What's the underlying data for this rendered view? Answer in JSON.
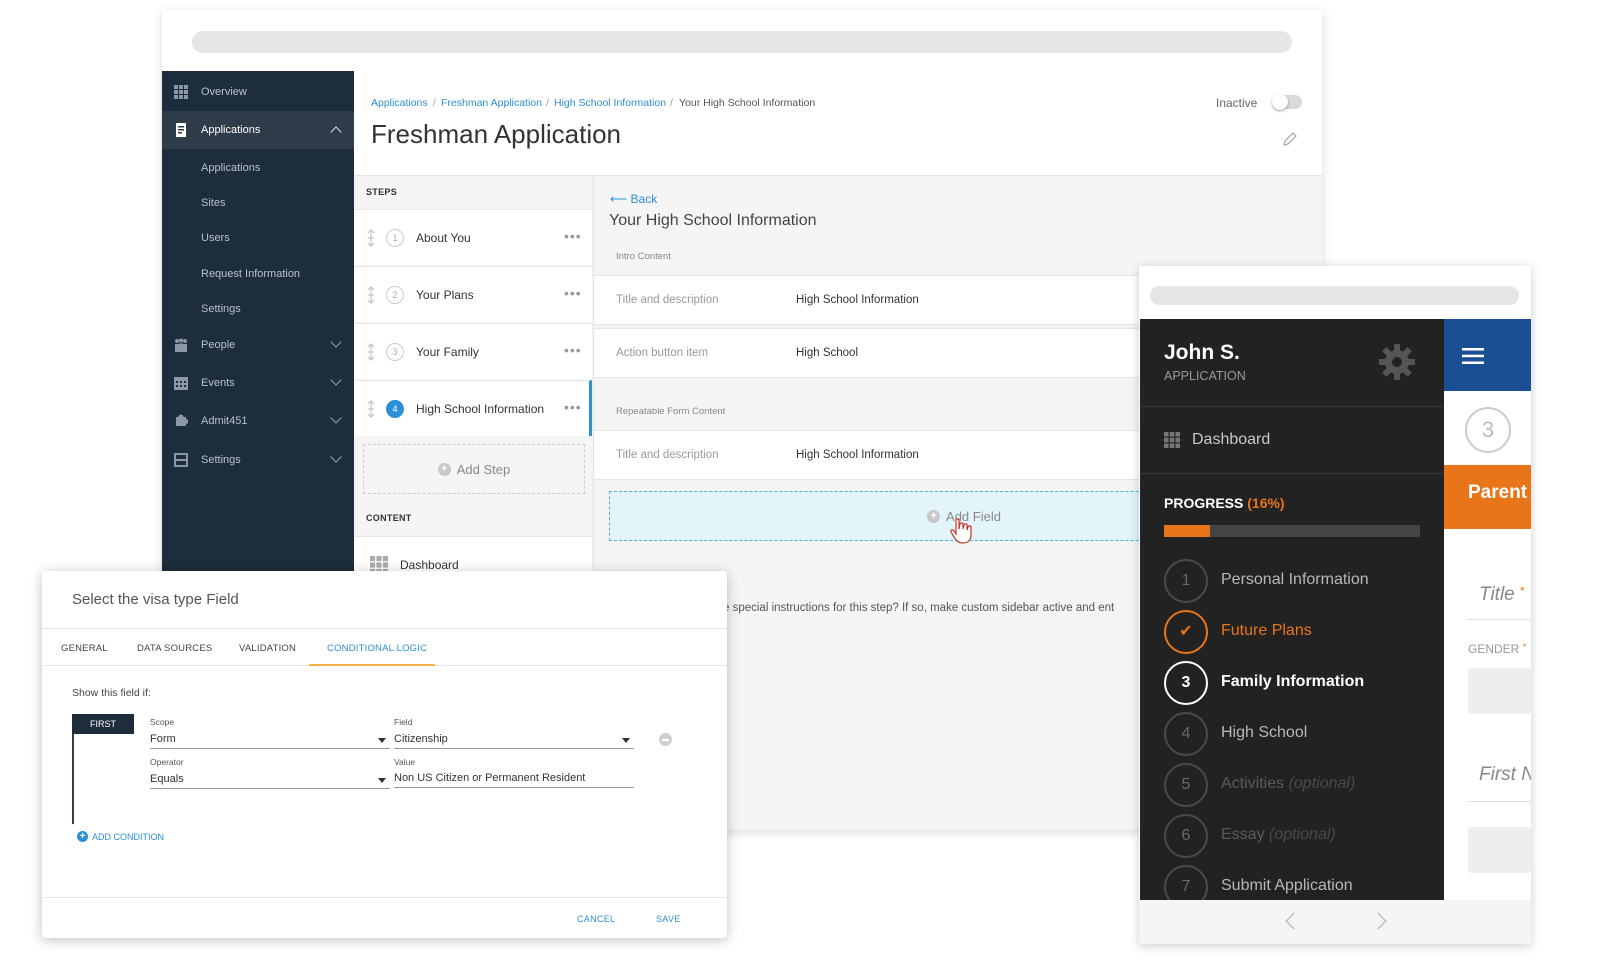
{
  "sidebar": {
    "items": [
      {
        "label": "Overview",
        "icon": "grid-icon"
      },
      {
        "label": "Applications",
        "icon": "document-icon"
      },
      {
        "label": "People",
        "icon": "people-icon"
      },
      {
        "label": "Events",
        "icon": "calendar-icon"
      },
      {
        "label": "Admit451",
        "icon": "puzzle-icon"
      },
      {
        "label": "Settings",
        "icon": "settings-panel-icon"
      }
    ],
    "sub_items": [
      "Applications",
      "Sites",
      "Users",
      "Request Information",
      "Settings"
    ]
  },
  "breadcrumb": [
    "Applications",
    "Freshman Application",
    "High School Information",
    "Your High School Information"
  ],
  "breadcrumb_separator": "/",
  "page_title": "Freshman Application",
  "status": {
    "label": "Inactive"
  },
  "steps_panel": {
    "header": "STEPS",
    "steps": [
      {
        "number": "1",
        "name": "About You"
      },
      {
        "number": "2",
        "name": "Your Plans"
      },
      {
        "number": "3",
        "name": "Your Family"
      },
      {
        "number": "4",
        "name": "High School Information"
      }
    ],
    "add_step_label": "Add Step",
    "content_header": "CONTENT",
    "content_items": [
      "Dashboard"
    ]
  },
  "detail": {
    "back_label": "Back",
    "title": "Your High School Information",
    "intro_label": "Intro Content",
    "rows": [
      {
        "key": "Title and description",
        "value": "High School Information"
      },
      {
        "key": "Action button item",
        "value": "High School"
      }
    ],
    "repeatable_label": "Repeatable Form Content",
    "repeatable_rows": [
      {
        "key": "Title and description",
        "value": "High School Information"
      }
    ],
    "add_field_label": "Add Field",
    "custom_sidebar_text": "e special instructions for this step? If so, make custom sidebar active and ent"
  },
  "modal": {
    "title": "Select the visa type Field",
    "tabs": [
      "GENERAL",
      "DATA SOURCES",
      "VALIDATION",
      "CONDITIONAL LOGIC"
    ],
    "active_tab": "CONDITIONAL LOGIC",
    "show_if_label": "Show this field if:",
    "first_badge": "FIRST",
    "condition": {
      "scope_label": "Scope",
      "scope_value": "Form",
      "field_label": "Field",
      "field_value": "Citizenship",
      "operator_label": "Operator",
      "operator_value": "Equals",
      "value_label": "Value",
      "value_value": "Non US Citizen or Permanent Resident"
    },
    "add_condition_label": "ADD CONDITION",
    "cancel_label": "CANCEL",
    "save_label": "SAVE"
  },
  "mobile": {
    "user_name": "John S.",
    "user_subtitle": "APPLICATION",
    "dashboard_label": "Dashboard",
    "progress_label": "PROGRESS",
    "progress_pct_label": "(16%)",
    "progress_value": 0.18,
    "steps": [
      {
        "number": "1",
        "name": "Personal Information",
        "optional": "",
        "state": "near"
      },
      {
        "number": "✔",
        "name": "Future Plans",
        "optional": "",
        "state": "done"
      },
      {
        "number": "3",
        "name": "Family Information",
        "optional": "",
        "state": "current"
      },
      {
        "number": "4",
        "name": "High School",
        "optional": "",
        "state": "near"
      },
      {
        "number": "5",
        "name": "Activities",
        "optional": "(optional)",
        "state": "future"
      },
      {
        "number": "6",
        "name": "Essay",
        "optional": "(optional)",
        "state": "future"
      },
      {
        "number": "7",
        "name": "Submit Application",
        "optional": "",
        "state": "near"
      }
    ],
    "right_step_number": "3",
    "banner_text": "Parent",
    "title_field_label": "Title",
    "required_mark": "*",
    "gender_label": "GENDER",
    "first_name_label": "First N",
    "colors": {
      "accent": "#e8751a",
      "header": "#1a4f94",
      "dark": "#222222"
    }
  },
  "colors": {
    "sidebar": "#1e2d3b",
    "link": "#2d8fd5",
    "tab_underline": "#f0b04a"
  }
}
